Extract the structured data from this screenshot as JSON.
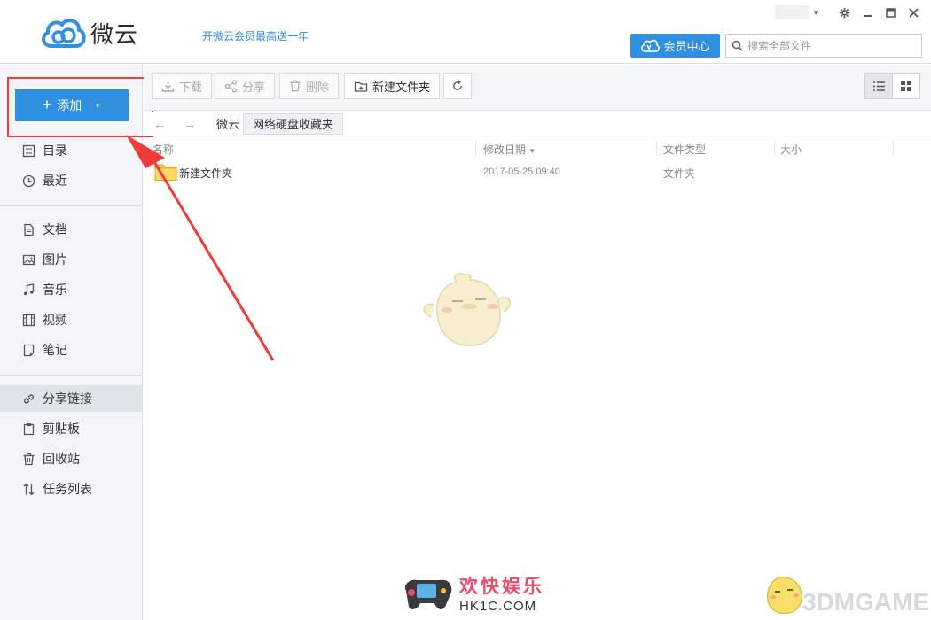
{
  "app": {
    "title": "微云",
    "promo": "开微云会员最高送一年"
  },
  "header": {
    "vip_label": "会员中心",
    "search_placeholder": "搜索全部文件"
  },
  "sidebar": {
    "add_label": "添加",
    "items": [
      {
        "label": "目录",
        "icon": "list-icon"
      },
      {
        "label": "最近",
        "icon": "clock-icon"
      },
      {
        "label": "文档",
        "icon": "document-icon"
      },
      {
        "label": "图片",
        "icon": "image-icon"
      },
      {
        "label": "音乐",
        "icon": "music-icon"
      },
      {
        "label": "视频",
        "icon": "video-icon"
      },
      {
        "label": "笔记",
        "icon": "note-icon"
      },
      {
        "label": "分享链接",
        "icon": "link-icon"
      },
      {
        "label": "剪贴板",
        "icon": "clipboard-icon"
      },
      {
        "label": "回收站",
        "icon": "trash-icon"
      },
      {
        "label": "任务列表",
        "icon": "transfer-icon"
      }
    ]
  },
  "toolbar": {
    "download_label": "下载",
    "share_label": "分享",
    "delete_label": "删除",
    "new_folder_label": "新建文件夹"
  },
  "breadcrumb": {
    "root": "微云",
    "current": "网络硬盘收藏夹"
  },
  "columns": {
    "name": "名称",
    "modified": "修改日期",
    "type": "文件类型",
    "size": "大小"
  },
  "files": [
    {
      "name": "新建文件夹",
      "modified": "2017-05-25 09:40",
      "type": "文件夹",
      "size": ""
    }
  ],
  "watermark": {
    "cn": "欢快娱乐",
    "domain": "HK1C.COM",
    "brand": "3DMGAME"
  },
  "colors": {
    "accent": "#2f8fe0",
    "highlight": "#ef3b3b",
    "sidebar_bg": "#f3f5f8"
  }
}
